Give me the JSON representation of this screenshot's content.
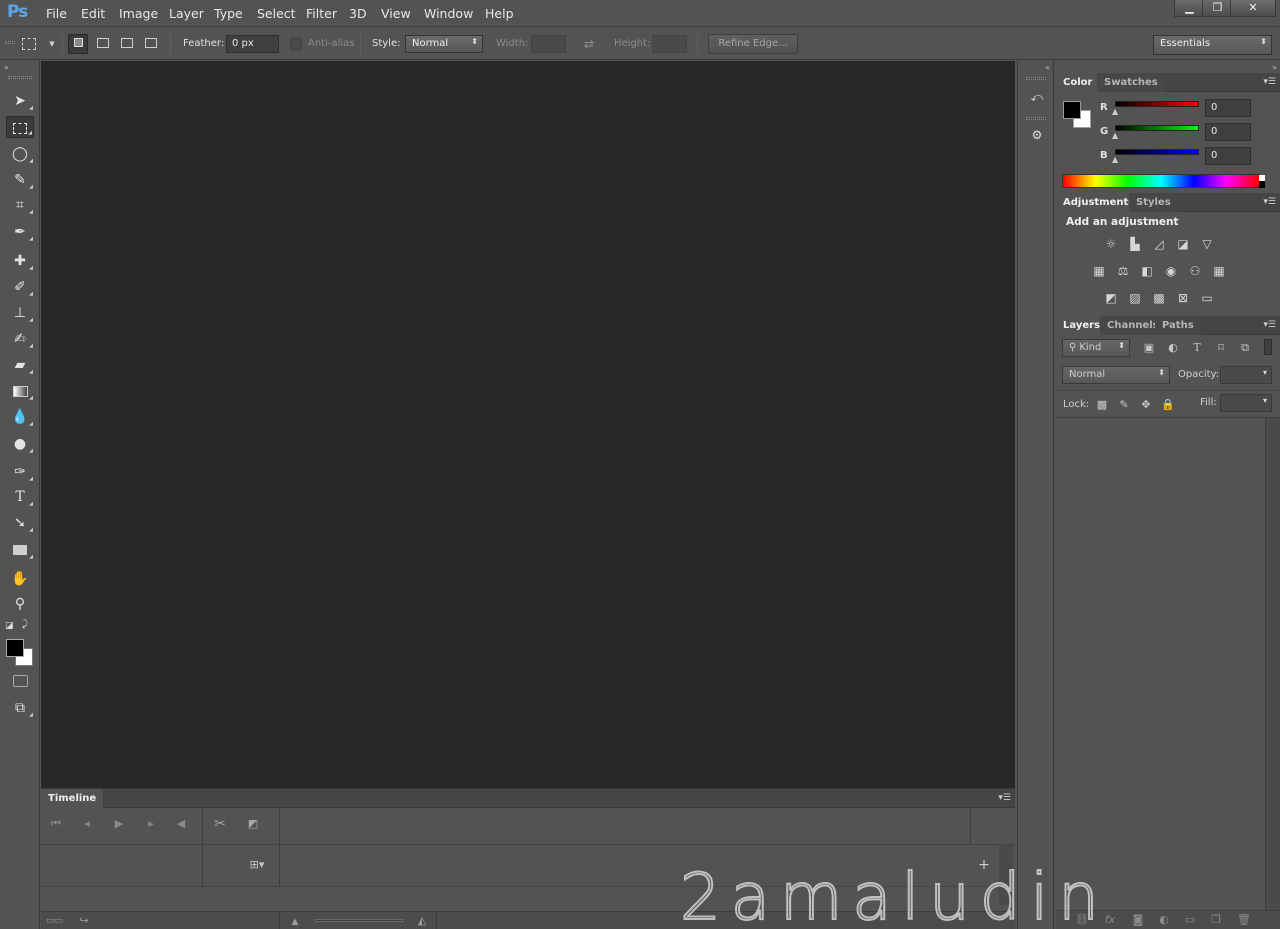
{
  "app": {
    "logo": "Ps"
  },
  "menu": [
    "File",
    "Edit",
    "Image",
    "Layer",
    "Type",
    "Select",
    "Filter",
    "3D",
    "View",
    "Window",
    "Help"
  ],
  "window_controls": {
    "minimize": "▁",
    "restore": "❐",
    "close": "✕"
  },
  "options": {
    "feather_label": "Feather:",
    "feather_value": "0 px",
    "antialias_label": "Anti-alias",
    "style_label": "Style:",
    "style_value": "Normal",
    "width_label": "Width:",
    "height_label": "Height:",
    "refine_edge": "Refine Edge...",
    "workspace": "Essentials"
  },
  "timeline": {
    "tab": "Timeline"
  },
  "color_panel": {
    "tabs": [
      "Color",
      "Swatches"
    ],
    "channels": [
      {
        "label": "R",
        "value": "0",
        "color": "#ff0000"
      },
      {
        "label": "G",
        "value": "0",
        "color": "#00ff00"
      },
      {
        "label": "B",
        "value": "0",
        "color": "#0000ff"
      }
    ],
    "foreground": "#000000",
    "background": "#ffffff"
  },
  "adjustments_panel": {
    "tabs": [
      "Adjustments",
      "Styles"
    ],
    "heading": "Add an adjustment"
  },
  "layers_panel": {
    "tabs": [
      "Layers",
      "Channels",
      "Paths"
    ],
    "filter_kind": "Kind",
    "blend_mode": "Normal",
    "opacity_label": "Opacity:",
    "lock_label": "Lock:",
    "fill_label": "Fill:"
  },
  "watermark": "2amaludin"
}
